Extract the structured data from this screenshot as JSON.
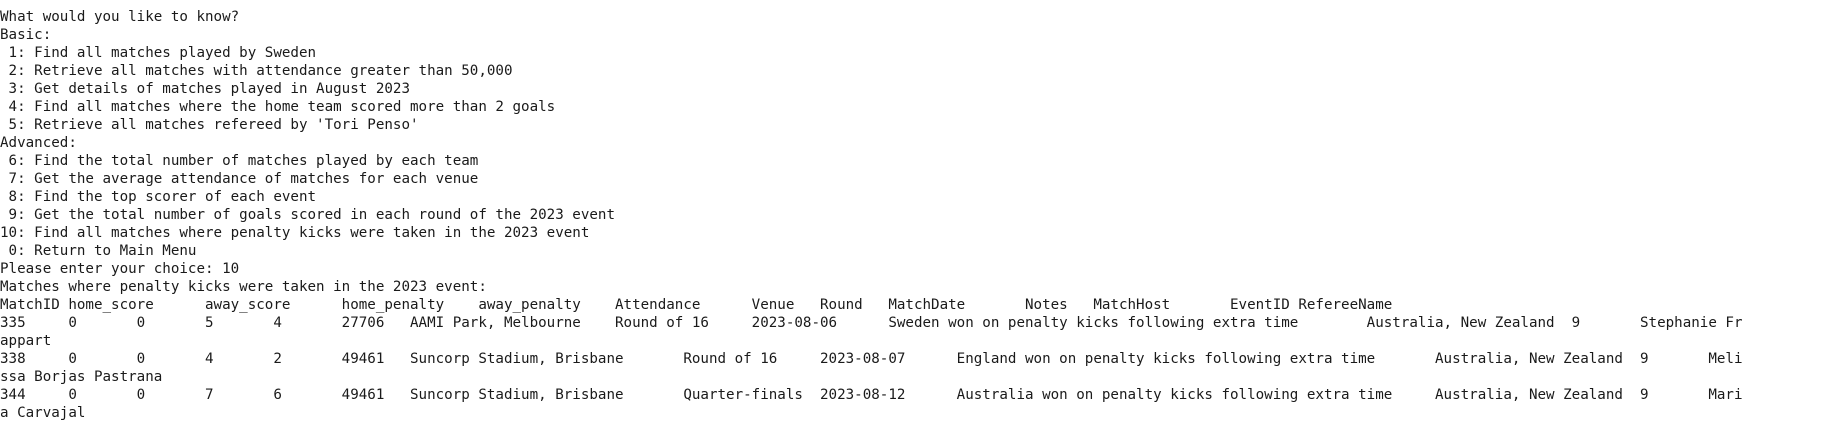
{
  "terminal": {
    "lines": [
      "What would you like to know?",
      "Basic:",
      " 1: Find all matches played by Sweden",
      " 2: Retrieve all matches with attendance greater than 50,000",
      " 3: Get details of matches played in August 2023",
      " 4: Find all matches where the home team scored more than 2 goals",
      " 5: Retrieve all matches refereed by 'Tori Penso'",
      "Advanced:",
      " 6: Find the total number of matches played by each team",
      " 7: Get the average attendance of matches for each venue",
      " 8: Find the top scorer of each event",
      " 9: Get the total number of goals scored in each round of the 2023 event",
      "10: Find all matches where penalty kicks were taken in the 2023 event",
      " 0: Return to Main Menu",
      "Please enter your choice: 10",
      "Matches where penalty kicks were taken in the 2023 event:",
      "MatchID home_score      away_score      home_penalty    away_penalty    Attendance      Venue   Round   MatchDate       Notes   MatchHost       EventID RefereeName",
      "335     0       0       5       4       27706   AAMI Park, Melbourne    Round of 16     2023-08-06      Sweden won on penalty kicks following extra time        Australia, New Zealand  9       Stephanie Fr",
      "appart",
      "338     0       0       4       2       49461   Suncorp Stadium, Brisbane       Round of 16     2023-08-07      England won on penalty kicks following extra time       Australia, New Zealand  9       Meli",
      "ssa Borjas Pastrana",
      "344     0       0       7       6       49461   Suncorp Stadium, Brisbane       Quarter-finals  2023-08-12      Australia won on penalty kicks following extra time     Australia, New Zealand  9       Mari",
      "a Carvajal"
    ]
  }
}
